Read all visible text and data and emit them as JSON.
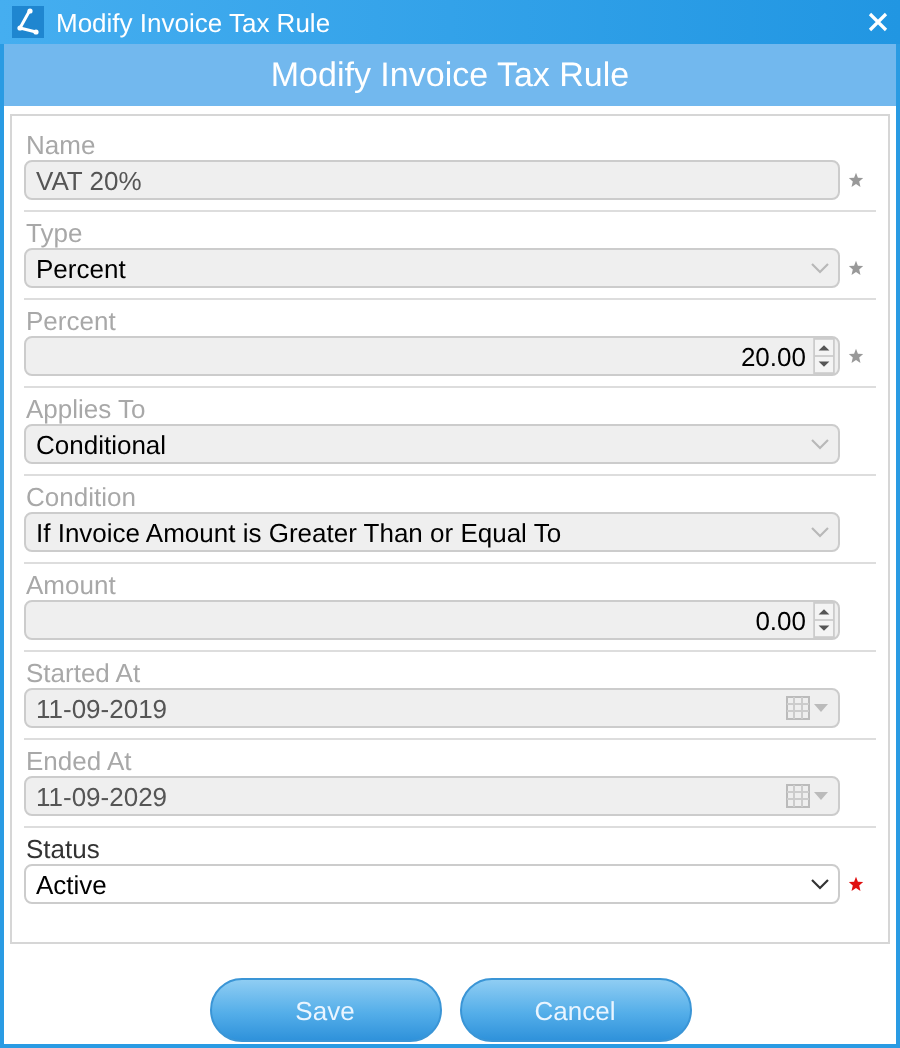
{
  "window": {
    "title": "Modify Invoice Tax Rule"
  },
  "header": {
    "title": "Modify Invoice Tax Rule"
  },
  "fields": [
    {
      "label": "Name",
      "kind": "text",
      "value": "VAT 20%",
      "disabled": true,
      "required": true
    },
    {
      "label": "Type",
      "kind": "select",
      "value": "Percent",
      "disabled": true,
      "required": true
    },
    {
      "label": "Percent",
      "kind": "number",
      "value": "20.00",
      "disabled": true,
      "required": true
    },
    {
      "label": "Applies To",
      "kind": "select",
      "value": "Conditional",
      "disabled": true,
      "required": false
    },
    {
      "label": "Condition",
      "kind": "select",
      "value": "If Invoice Amount is Greater Than or Equal To",
      "disabled": true,
      "required": false
    },
    {
      "label": "Amount",
      "kind": "number",
      "value": "0.00",
      "disabled": true,
      "required": false
    },
    {
      "label": "Started At",
      "kind": "date",
      "value": "11-09-2019",
      "disabled": true,
      "required": false
    },
    {
      "label": "Ended At",
      "kind": "date",
      "value": "11-09-2029",
      "disabled": true,
      "required": false
    },
    {
      "label": "Status",
      "kind": "select",
      "value": "Active",
      "disabled": false,
      "required": true
    }
  ],
  "buttons": [
    {
      "label": "Save"
    },
    {
      "label": "Cancel"
    }
  ]
}
